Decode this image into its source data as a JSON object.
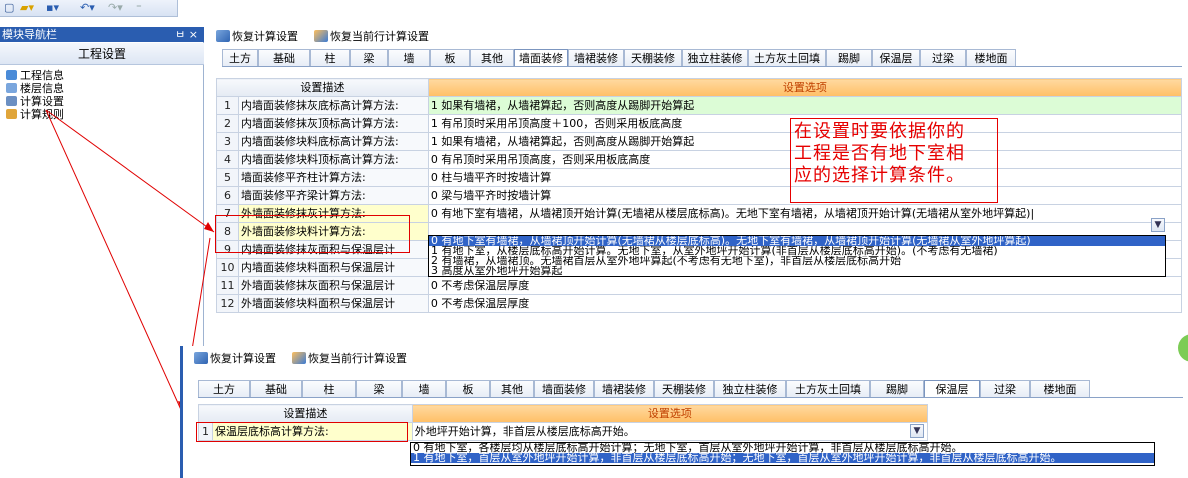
{
  "nav": {
    "title": "模块导航栏",
    "pin": "ㅂ ×",
    "section": "工程设置",
    "items": [
      "工程信息",
      "楼层信息",
      "计算设置",
      "计算规则"
    ]
  },
  "toolbar": {
    "restore": "恢复计算设置",
    "restore_row": "恢复当前行计算设置"
  },
  "tabs": [
    "土方",
    "基础",
    "柱",
    "梁",
    "墙",
    "板",
    "其他",
    "墙面装修",
    "墙裙装修",
    "天棚装修",
    "独立柱装修",
    "土方灰土回填",
    "踢脚",
    "保温层",
    "过梁",
    "楼地面"
  ],
  "table": {
    "header_desc": "设置描述",
    "header_opt": "设置选项",
    "rows": [
      {
        "n": "1",
        "d": "内墙面装修抹灰底标高计算方法:",
        "o": "1 如果有墙裙，从墙裙算起，否则高度从踢脚开始算起"
      },
      {
        "n": "2",
        "d": "内墙面装修抹灰顶标高计算方法:",
        "o": "1 有吊顶时采用吊顶高度＋100，否则采用板底高度"
      },
      {
        "n": "3",
        "d": "内墙面装修块料底标高计算方法:",
        "o": "1 如果有墙裙，从墙裙算起，否则高度从踢脚开始算起"
      },
      {
        "n": "4",
        "d": "内墙面装修块料顶标高计算方法:",
        "o": "0 有吊顶时采用吊顶高度，否则采用板底高度"
      },
      {
        "n": "5",
        "d": "墙面装修平齐柱计算方法:",
        "o": "0 柱与墙平齐时按墙计算"
      },
      {
        "n": "6",
        "d": "墙面装修平齐梁计算方法:",
        "o": "0 梁与墙平齐时按墙计算"
      },
      {
        "n": "7",
        "d": "外墙面装修抹灰计算方法:",
        "o": "0 有地下室有墙裙，从墙裙顶开始计算(无墙裙从楼层底标高)。无地下室有墙裙，从墙裙顶开始计算(无墙裙从室外地坪算起)|"
      },
      {
        "n": "8",
        "d": "外墙面装修块料计算方法:",
        "o": ""
      },
      {
        "n": "9",
        "d": "内墙面装修抹灰面积与保温层计",
        "o": ""
      },
      {
        "n": "10",
        "d": "内墙面装修块料面积与保温层计",
        "o": ""
      },
      {
        "n": "11",
        "d": "外墙面装修抹灰面积与保温层计",
        "o": "0 不考虑保温层厚度"
      },
      {
        "n": "12",
        "d": "外墙面装修块料面积与保温层计",
        "o": "0 不考虑保温层厚度"
      }
    ],
    "dropdown": [
      "0 有地下室有墙裙，从墙裙顶开始计算(无墙裙从楼层底标高)。无地下室有墙裙，从墙裙顶开始计算(无墙裙从室外地坪算起)",
      "1 有地下室，从楼层底标高开始计算。无地下室，从室外地坪开始计算(非首层从楼层底标高开始)。(不考虑有无墙裙)",
      "2 有墙裙，从墙裙顶。无墙裙首层从室外地坪算起(不考虑有无地下室)，非首层从楼层底标高开始",
      "3 高度从室外地坪开始算起"
    ]
  },
  "note": [
    "在设置时要依据你的",
    "工程是否有地下室相",
    "应的选择计算条件。"
  ],
  "table2": {
    "header_desc": "设置描述",
    "header_opt": "设置选项",
    "row": {
      "n": "1",
      "d": "保温层底标高计算方法:",
      "o": "外地坪开始计算，非首层从楼层底标高开始。"
    },
    "dropdown": [
      "0 有地下室，各楼层均从楼层底标高开始计算；无地下室，首层从室外地坪开始计算，非首层从楼层底标高开始。",
      "1 有地下室，首层从室外地坪开始计算，非首层从楼层底标高开始；无地下室，首层从室外地坪开始计算，非首层从楼层底标高开始。"
    ]
  },
  "colors": {
    "accent": "#2a5db0",
    "red": "#e00000",
    "header_orange": "#ffbf66",
    "green_row": "#dcfcd6"
  }
}
